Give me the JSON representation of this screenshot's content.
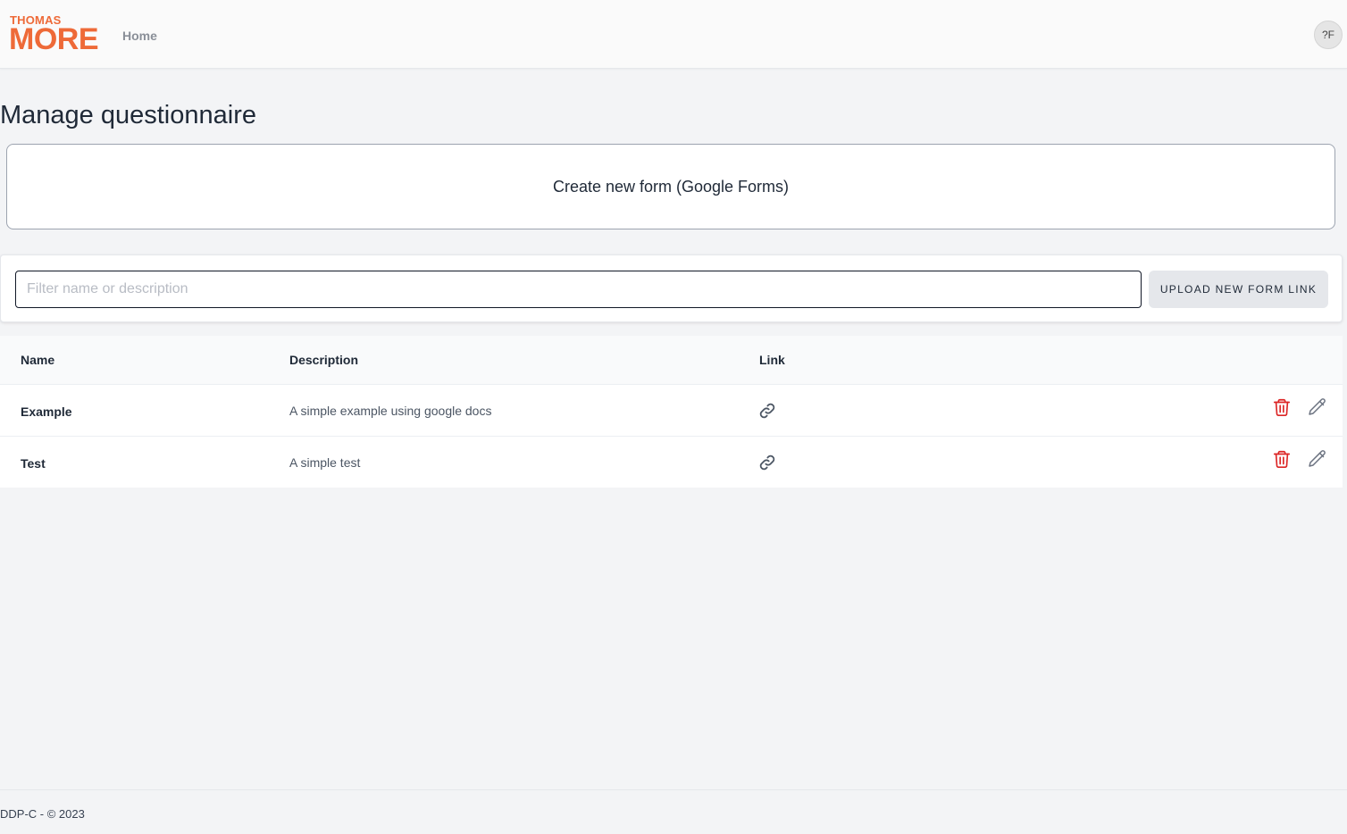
{
  "header": {
    "logo_top": "THOMAS",
    "logo_main": "MORE",
    "nav_home": "Home",
    "avatar_initials": "?F",
    "brand_color": "#ee6a38"
  },
  "page": {
    "title": "Manage questionnaire",
    "create_label": "Create new form (Google Forms)"
  },
  "filter": {
    "placeholder": "Filter name or description",
    "value": "",
    "upload_label": "UPLOAD NEW FORM LINK"
  },
  "table": {
    "columns": [
      "Name",
      "Description",
      "Link"
    ],
    "rows": [
      {
        "name": "Example",
        "description": "A simple example using google docs",
        "link_icon": "link-icon",
        "actions": [
          "trash-icon",
          "pencil-icon"
        ]
      },
      {
        "name": "Test",
        "description": "A simple test",
        "link_icon": "link-icon",
        "actions": [
          "trash-icon",
          "pencil-icon"
        ]
      }
    ]
  },
  "colors": {
    "delete": "#dc2626",
    "edit": "#6b7280"
  },
  "footer": {
    "text": "DDP-C - © 2023"
  }
}
